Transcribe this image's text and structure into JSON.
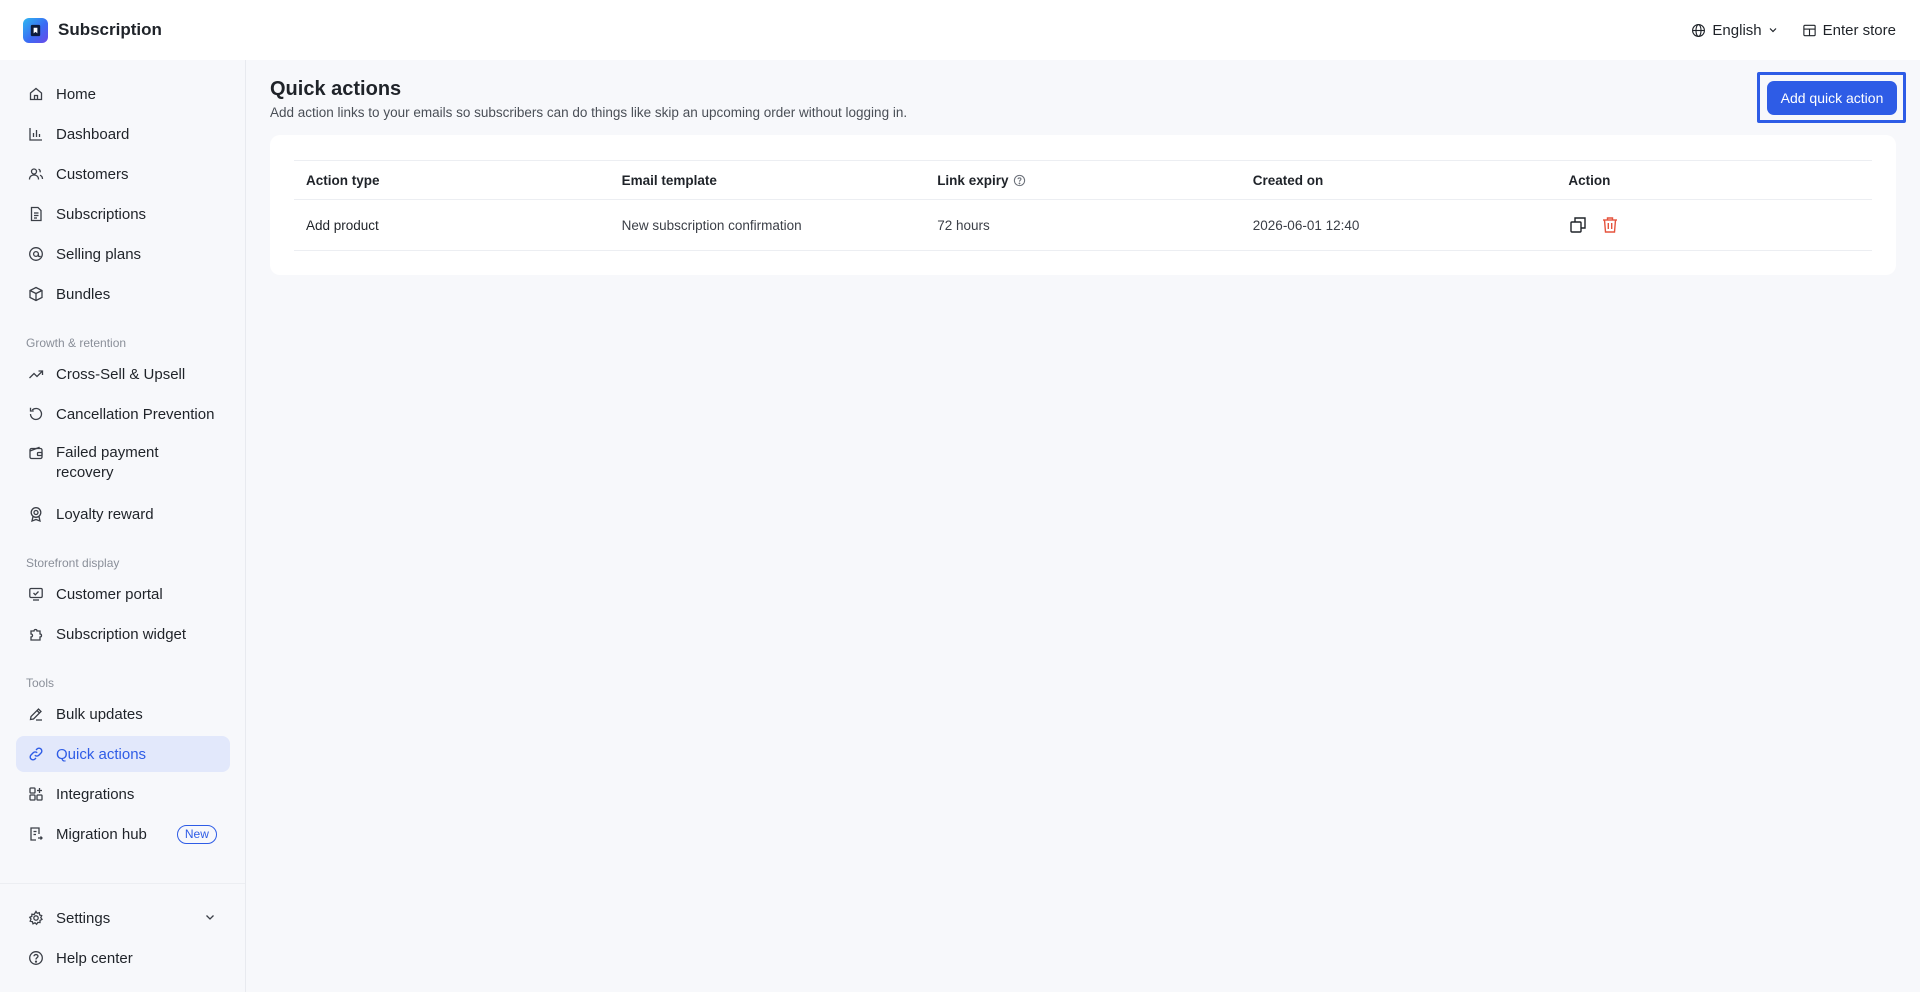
{
  "app": {
    "title": "Subscription",
    "language": "English",
    "enter_store": "Enter store"
  },
  "sidebar": {
    "items": [
      {
        "label": "Home",
        "icon": "home-icon"
      },
      {
        "label": "Dashboard",
        "icon": "bar-chart-icon"
      },
      {
        "label": "Customers",
        "icon": "users-icon"
      },
      {
        "label": "Subscriptions",
        "icon": "document-icon"
      },
      {
        "label": "Selling plans",
        "icon": "percent-tag-icon"
      },
      {
        "label": "Bundles",
        "icon": "box-icon"
      }
    ],
    "growth_label": "Growth & retention",
    "growth_items": [
      {
        "label": "Cross-Sell & Upsell",
        "icon": "trend-up-icon"
      },
      {
        "label": "Cancellation Prevention",
        "icon": "rotate-ccw-icon"
      },
      {
        "label": "Failed payment recovery",
        "icon": "wallet-icon"
      },
      {
        "label": "Loyalty reward",
        "icon": "award-icon"
      }
    ],
    "storefront_label": "Storefront display",
    "storefront_items": [
      {
        "label": "Customer portal",
        "icon": "monitor-icon"
      },
      {
        "label": "Subscription widget",
        "icon": "puzzle-icon"
      }
    ],
    "tools_label": "Tools",
    "tools_items": [
      {
        "label": "Bulk updates",
        "icon": "pen-icon"
      },
      {
        "label": "Quick actions",
        "icon": "link-icon",
        "active": true
      },
      {
        "label": "Integrations",
        "icon": "grid-plus-icon"
      },
      {
        "label": "Migration hub",
        "icon": "file-export-icon",
        "badge": "New"
      }
    ],
    "settings": "Settings",
    "help": "Help center"
  },
  "main": {
    "title": "Quick actions",
    "description": "Add action links to your emails so subscribers can do things like skip an upcoming order without logging in.",
    "add_button": "Add quick action",
    "table": {
      "columns": [
        "Action type",
        "Email template",
        "Link expiry",
        "Created on",
        "Action"
      ],
      "rows": [
        {
          "action_type": "Add product",
          "email_template": "New subscription confirmation",
          "link_expiry": "72 hours",
          "created_on": "2026-06-01 12:40"
        }
      ]
    }
  },
  "colors": {
    "accent": "#2e5ce6",
    "active_bg": "#e2e8fb",
    "danger": "#e5533d",
    "page_bg": "#f7f8fb"
  }
}
